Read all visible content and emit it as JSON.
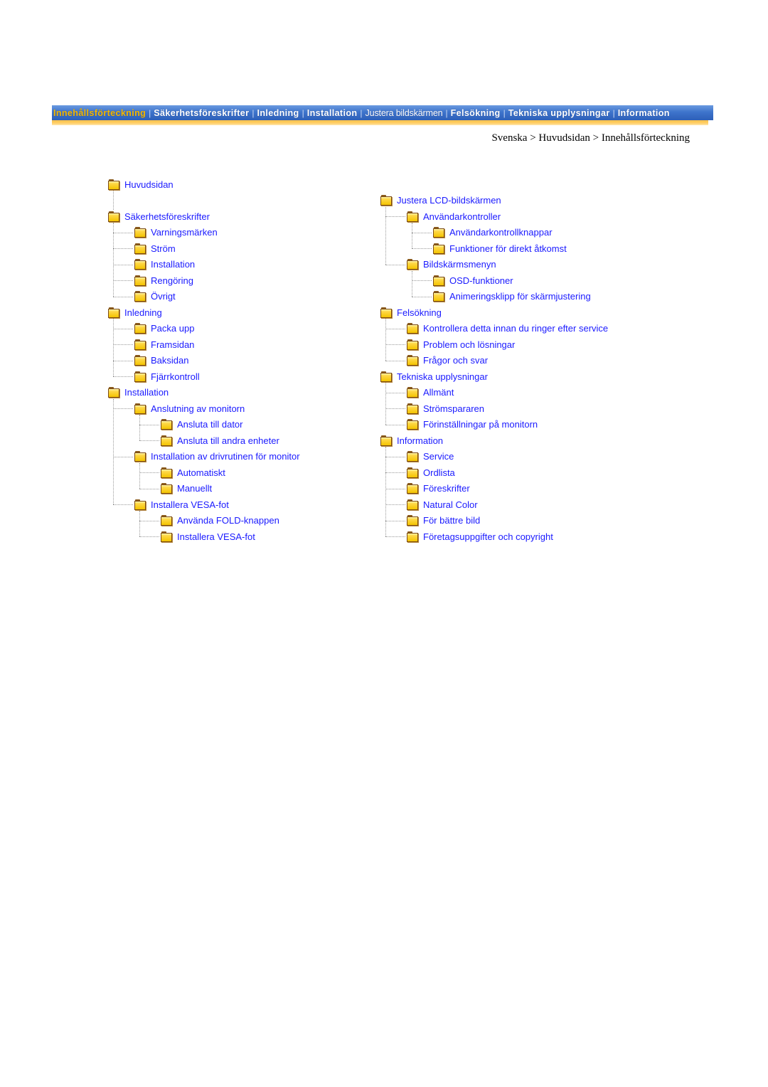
{
  "nav": {
    "items": [
      {
        "label": "Innehållsförteckning",
        "active": true
      },
      {
        "label": "Säkerhetsföreskrifter"
      },
      {
        "label": "Inledning"
      },
      {
        "label": "Installation"
      },
      {
        "label": "Justera bildskärmen",
        "light": true
      },
      {
        "label": "Felsökning"
      },
      {
        "label": "Tekniska upplysningar"
      },
      {
        "label": "Information"
      }
    ],
    "separator": "|",
    "colors": {
      "bar": "#3e74cc",
      "active_text": "#f5b800",
      "underline": "#ffc24a"
    }
  },
  "breadcrumb": {
    "items": [
      "Svenska",
      "Huvudsidan",
      "Innehållsförteckning"
    ],
    "separator": ">"
  },
  "link_color": "#1a1aff",
  "tree_left": [
    {
      "label": "Huvudsidan",
      "level": 0
    },
    {
      "label": "",
      "level": -1
    },
    {
      "label": "Säkerhetsföreskrifter",
      "level": 0,
      "children": [
        {
          "label": "Varningsmärken"
        },
        {
          "label": "Ström"
        },
        {
          "label": "Installation"
        },
        {
          "label": "Rengöring"
        },
        {
          "label": "Övrigt"
        }
      ]
    },
    {
      "label": "Inledning",
      "level": 0,
      "children": [
        {
          "label": "Packa upp"
        },
        {
          "label": "Framsidan"
        },
        {
          "label": "Baksidan"
        },
        {
          "label": "Fjärrkontroll"
        }
      ]
    },
    {
      "label": "Installation",
      "level": 0,
      "children": [
        {
          "label": "Anslutning av monitorn",
          "children": [
            {
              "label": "Ansluta till dator"
            },
            {
              "label": "Ansluta till andra enheter"
            }
          ]
        },
        {
          "label": "Installation av drivrutinen för monitor",
          "children": [
            {
              "label": "Automatiskt"
            },
            {
              "label": "Manuellt"
            }
          ]
        },
        {
          "label": "Installera VESA-fot",
          "children": [
            {
              "label": "Använda FOLD-knappen"
            },
            {
              "label": "Installera VESA-fot"
            }
          ]
        }
      ]
    }
  ],
  "tree_right": [
    {
      "label": "Justera LCD-bildskärmen",
      "children": [
        {
          "label": "Användarkontroller",
          "children": [
            {
              "label": "Användarkontrollknappar"
            },
            {
              "label": "Funktioner för direkt åtkomst"
            }
          ]
        },
        {
          "label": "Bildskärmsmenyn",
          "children": [
            {
              "label": "OSD-funktioner"
            },
            {
              "label": "Animeringsklipp för skärmjustering"
            }
          ]
        }
      ]
    },
    {
      "label": "Felsökning",
      "children": [
        {
          "label": "Kontrollera detta innan du ringer efter service"
        },
        {
          "label": "Problem och lösningar"
        },
        {
          "label": "Frågor och svar"
        }
      ]
    },
    {
      "label": "Tekniska upplysningar",
      "children": [
        {
          "label": "Allmänt"
        },
        {
          "label": "Strömspararen"
        },
        {
          "label": "Förinställningar på monitorn"
        }
      ]
    },
    {
      "label": "Information",
      "children": [
        {
          "label": "Service"
        },
        {
          "label": "Ordlista"
        },
        {
          "label": "Föreskrifter"
        },
        {
          "label": "Natural Color"
        },
        {
          "label": "För bättre bild"
        },
        {
          "label": "Företagsuppgifter och copyright"
        }
      ]
    }
  ]
}
